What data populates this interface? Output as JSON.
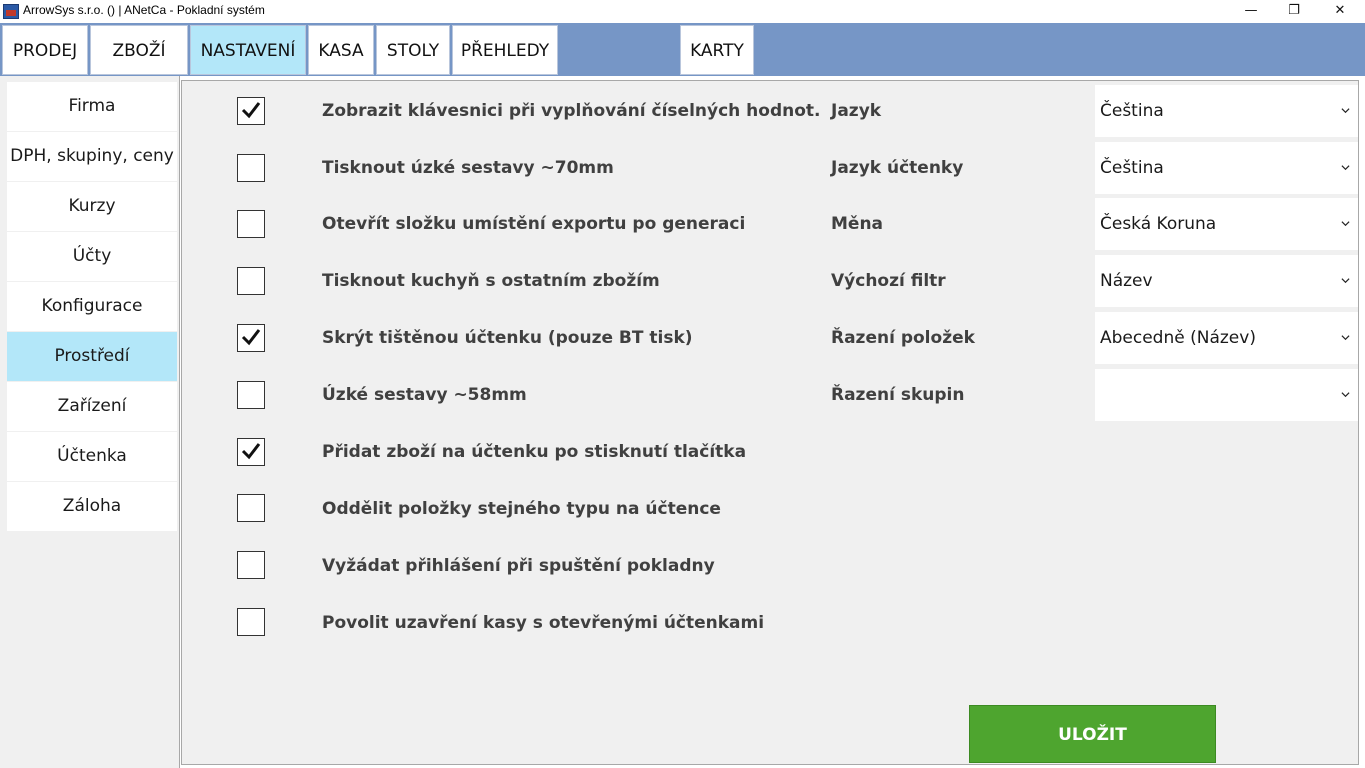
{
  "window": {
    "title": "ArrowSys s.r.o. () | ANetCa - Pokladní systém",
    "controls": {
      "minimize": "—",
      "restore": "❐",
      "close": "✕"
    }
  },
  "nav": {
    "tabs": [
      {
        "label": "PRODEJ",
        "active": false
      },
      {
        "label": "ZBOŽÍ",
        "active": false
      },
      {
        "label": "NASTAVENÍ",
        "active": true
      },
      {
        "label": "KASA",
        "active": false
      },
      {
        "label": "STOLY",
        "active": false
      },
      {
        "label": "PŘEHLEDY",
        "active": false
      },
      {
        "label": "KARTY",
        "active": false
      }
    ]
  },
  "sidebar": {
    "items": [
      {
        "label": "Firma",
        "active": false
      },
      {
        "label": "DPH, skupiny, ceny",
        "active": false
      },
      {
        "label": "Kurzy",
        "active": false
      },
      {
        "label": "Účty",
        "active": false
      },
      {
        "label": "Konfigurace",
        "active": false
      },
      {
        "label": "Prostředí",
        "active": true
      },
      {
        "label": "Zařízení",
        "active": false
      },
      {
        "label": "Účtenka",
        "active": false
      },
      {
        "label": "Záloha",
        "active": false
      }
    ]
  },
  "settings": {
    "checkboxes": [
      {
        "label": "Zobrazit klávesnici při vyplňování číselných hodnot.",
        "checked": true
      },
      {
        "label": "Tisknout úzké sestavy ~70mm",
        "checked": false
      },
      {
        "label": "Otevřít složku umístění exportu po generaci",
        "checked": false
      },
      {
        "label": "Tisknout kuchyň s ostatním zbožím",
        "checked": false
      },
      {
        "label": "Skrýt tištěnou účtenku (pouze BT tisk)",
        "checked": true
      },
      {
        "label": "Úzké sestavy ~58mm",
        "checked": false
      },
      {
        "label": "Přidat zboží na účtenku po stisknutí tlačítka",
        "checked": true
      },
      {
        "label": "Oddělit položky stejného typu na účtence",
        "checked": false
      },
      {
        "label": "Vyžádat přihlášení při spuštění pokladny",
        "checked": false
      },
      {
        "label": "Povolit uzavření kasy s otevřenými účtenkami",
        "checked": false
      }
    ],
    "fields": [
      {
        "label": "Jazyk",
        "value": "Čeština"
      },
      {
        "label": "Jazyk účtenky",
        "value": "Čeština"
      },
      {
        "label": "Měna",
        "value": "Česká Koruna"
      },
      {
        "label": "Výchozí filtr",
        "value": "Název"
      },
      {
        "label": "Řazení položek",
        "value": "Abecedně (Název)"
      },
      {
        "label": "Řazení skupin",
        "value": ""
      }
    ],
    "save_label": "ULOŽIT"
  },
  "colors": {
    "nav_bg": "#7696c6",
    "active_tab": "#b3e7f9",
    "save_button": "#4ea52f"
  }
}
